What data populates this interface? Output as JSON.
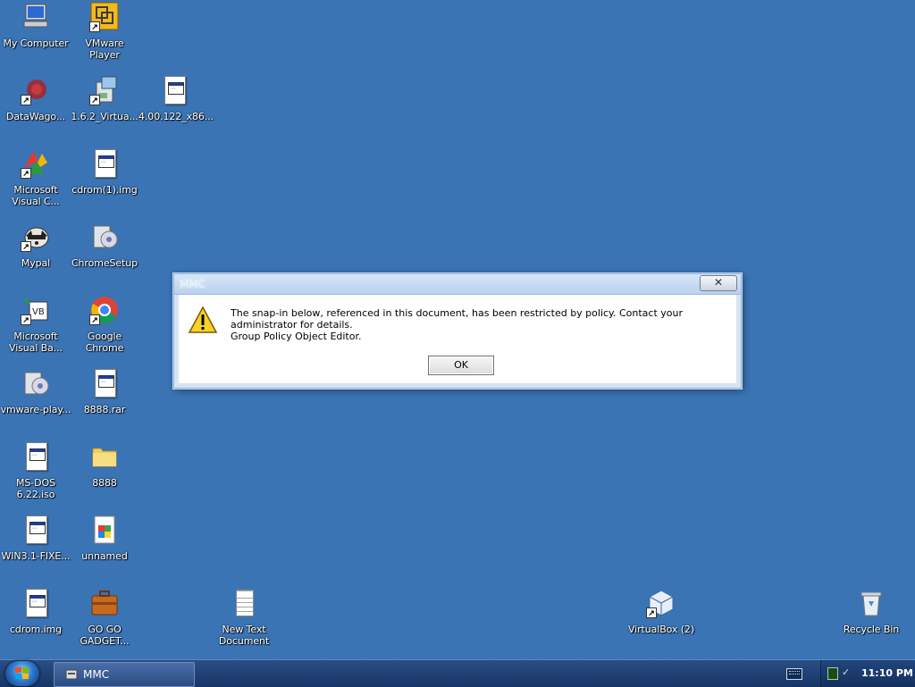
{
  "desktop": {
    "icons": [
      {
        "label": "My Computer",
        "name": "my-computer-icon"
      },
      {
        "label": "VMware Player",
        "name": "vmware-player-icon"
      },
      {
        "label": "DataWago...",
        "name": "datawago-icon"
      },
      {
        "label": "1.6.2_Virtua...",
        "name": "virtualbox-installer-icon"
      },
      {
        "label": "4.00.122_x86...",
        "name": "document-icon"
      },
      {
        "label": "Microsoft Visual C...",
        "name": "visual-c-icon"
      },
      {
        "label": "cdrom(1).img",
        "name": "image-file-icon"
      },
      {
        "label": "Mypal",
        "name": "mypal-icon"
      },
      {
        "label": "ChromeSetup",
        "name": "chrome-setup-icon"
      },
      {
        "label": "Microsoft Visual Ba...",
        "name": "visual-basic-icon"
      },
      {
        "label": "Google Chrome",
        "name": "chrome-icon"
      },
      {
        "label": "vmware-play...",
        "name": "vmware-setup-icon"
      },
      {
        "label": "8888.rar",
        "name": "archive-file-icon"
      },
      {
        "label": "MS-DOS 6.22.iso",
        "name": "iso-file-icon"
      },
      {
        "label": "8888",
        "name": "folder-icon"
      },
      {
        "label": "WIN3.1-FIXE...",
        "name": "document-icon"
      },
      {
        "label": "unnamed",
        "name": "image-file-icon"
      },
      {
        "label": "cdrom.img",
        "name": "image-file-icon"
      },
      {
        "label": "GO GO GADGET...",
        "name": "briefcase-icon"
      },
      {
        "label": "New Text Document",
        "name": "text-document-icon"
      },
      {
        "label": "VirtualBox (2)",
        "name": "virtualbox-icon"
      },
      {
        "label": "Recycle Bin",
        "name": "recycle-bin-icon"
      }
    ]
  },
  "dialog": {
    "title": "MMC",
    "close_glyph": "✕",
    "message_line1": "The snap-in below, referenced in this document, has been restricted by policy. Contact your administrator for details.",
    "message_line2": "Group Policy Object Editor.",
    "ok_label": "OK",
    "icon": "warning-icon"
  },
  "taskbar": {
    "start_icon": "windows-logo-icon",
    "task_label": "MMC",
    "clock": "11:10 PM",
    "tray_icons": [
      "keyboard-icon",
      "network-icon"
    ]
  },
  "colors": {
    "desktop": "#3a74b5",
    "taskbar": "#1d3d70"
  }
}
